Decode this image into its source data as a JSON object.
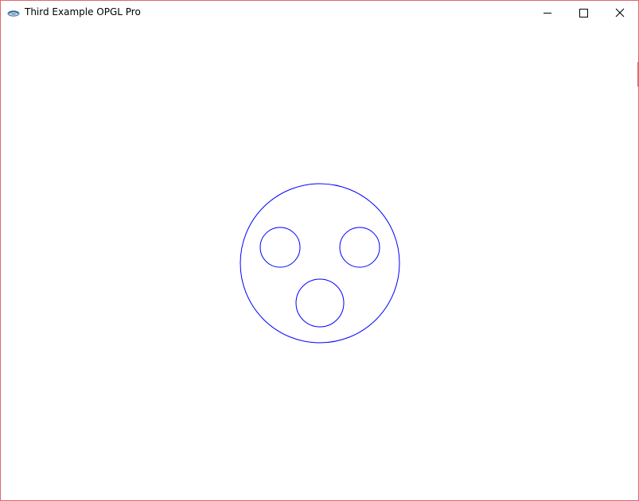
{
  "window": {
    "title": "Third Example OPGL Pro",
    "app_icon": "opengl-app-icon",
    "controls": {
      "minimize_icon": "minimize-icon",
      "maximize_icon": "maximize-icon",
      "close_icon": "close-icon"
    }
  },
  "scene": {
    "stroke_color": "#0000ff",
    "background_color": "#ffffff",
    "shapes": [
      "face-outline-circle",
      "left-eye-circle",
      "right-eye-circle",
      "mouth-circle"
    ]
  },
  "colors": {
    "window_border": "#e0686b"
  }
}
